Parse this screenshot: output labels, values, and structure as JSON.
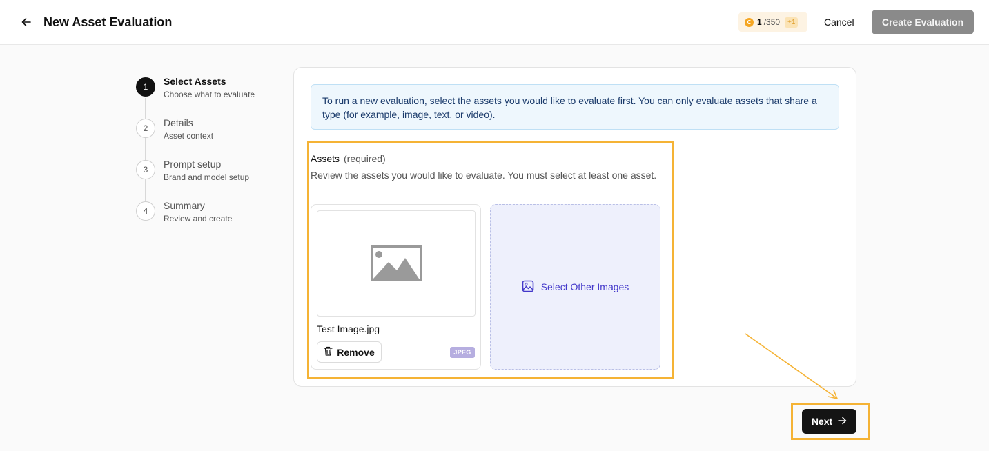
{
  "header": {
    "title": "New Asset Evaluation",
    "credits": {
      "used": "1",
      "total": "/350",
      "plus": "+1"
    },
    "cancel_label": "Cancel",
    "create_label": "Create Evaluation"
  },
  "steps": [
    {
      "number": "1",
      "title": "Select Assets",
      "subtitle": "Choose what to evaluate",
      "active": true
    },
    {
      "number": "2",
      "title": "Details",
      "subtitle": "Asset context",
      "active": false
    },
    {
      "number": "3",
      "title": "Prompt setup",
      "subtitle": "Brand and model setup",
      "active": false
    },
    {
      "number": "4",
      "title": "Summary",
      "subtitle": "Review and create",
      "active": false
    }
  ],
  "info_text": "To run a new evaluation, select the assets you would like to evaluate first. You can only evaluate assets that share a type (for example, image, text, or video).",
  "assets": {
    "label": "Assets",
    "required": "(required)",
    "description": "Review the assets you would like to evaluate. You must select at least one asset.",
    "items": [
      {
        "name": "Test Image.jpg",
        "type": "JPEG",
        "remove_label": "Remove"
      }
    ],
    "select_other_label": "Select Other Images"
  },
  "next_label": "Next",
  "colors": {
    "highlight": "#f5b335",
    "accent": "#4338ca",
    "info_bg": "#eef7fd"
  }
}
